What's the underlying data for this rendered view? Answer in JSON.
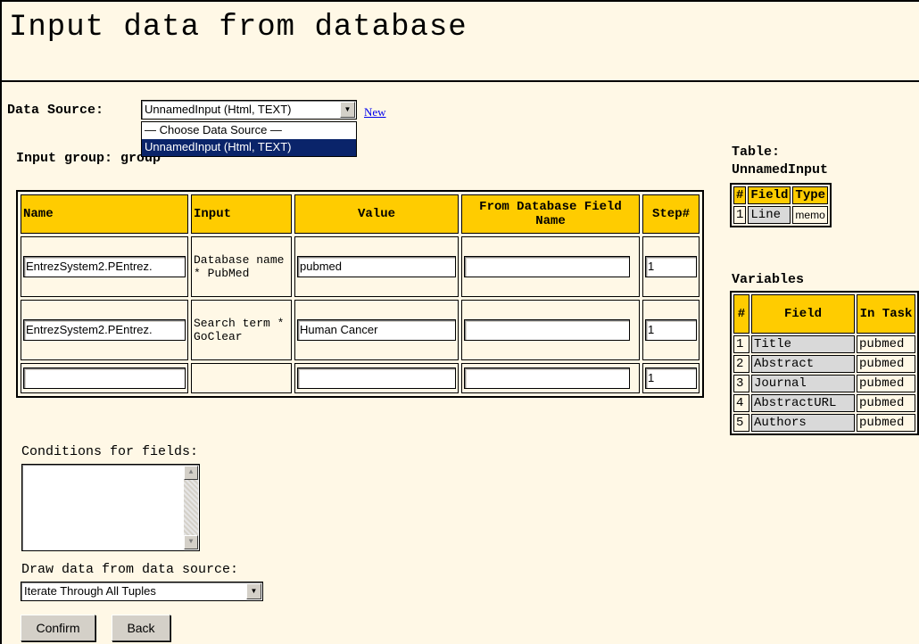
{
  "page_title": "Input data from database",
  "data_source": {
    "label": "Data Source:",
    "selected": "UnnamedInput (Html, TEXT)",
    "new_link": "New",
    "options": [
      "— Choose Data Source —",
      "UnnamedInput (Html, TEXT)"
    ]
  },
  "input_group": {
    "label": "Input group:",
    "value": "group"
  },
  "main_table": {
    "headers": [
      "Name",
      "Input",
      "Value",
      "From Database Field Name",
      "Step#"
    ],
    "rows": [
      {
        "name": "EntrezSystem2.PEntrez.",
        "input": "Database name * PubMed",
        "value": "pubmed",
        "field": "",
        "step": "1"
      },
      {
        "name": "EntrezSystem2.PEntrez.",
        "input": "Search term * GoClear",
        "value": "Human Cancer",
        "field": "",
        "step": "1"
      },
      {
        "name": "",
        "input": "",
        "value": "",
        "field": "",
        "step": "1"
      }
    ]
  },
  "table_panel": {
    "label": "Table:",
    "name": "UnnamedInput",
    "headers": [
      "#",
      "Field",
      "Type"
    ],
    "rows": [
      {
        "num": "1",
        "field": "Line",
        "type": "memo"
      }
    ]
  },
  "variables_panel": {
    "label": "Variables",
    "headers": [
      "#",
      "Field",
      "In Task"
    ],
    "rows": [
      {
        "num": "1",
        "field": "Title",
        "task": "pubmed"
      },
      {
        "num": "2",
        "field": "Abstract",
        "task": "pubmed"
      },
      {
        "num": "3",
        "field": "Journal",
        "task": "pubmed"
      },
      {
        "num": "4",
        "field": "AbstractURL",
        "task": "pubmed"
      },
      {
        "num": "5",
        "field": "Authors",
        "task": "pubmed"
      }
    ]
  },
  "conditions": {
    "label": "Conditions for fields:",
    "value": ""
  },
  "draw": {
    "label": "Draw data from data source:",
    "selected": "Iterate Through All Tuples"
  },
  "buttons": {
    "confirm": "Confirm",
    "back": "Back"
  },
  "icons": {
    "dropdown": "chevron-down-icon",
    "scroll_up": "scroll-up-icon",
    "scroll_down": "scroll-down-icon"
  },
  "colors": {
    "background": "#fff8e6",
    "header": "#ffcc00",
    "selection": "#0a246a",
    "link": "#0000ee"
  }
}
